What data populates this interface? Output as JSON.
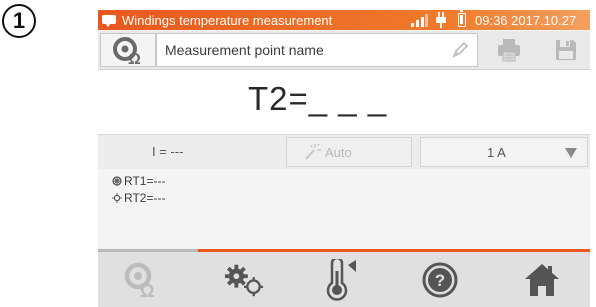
{
  "step_badge": "1",
  "status_bar": {
    "title": "Windings temperature measurement",
    "clock": "09:36 2017.10.27"
  },
  "name_row": {
    "placeholder": "Measurement point name"
  },
  "result": {
    "value": "T2=_ _ _"
  },
  "params": {
    "current": "I = ---",
    "auto_label": "Auto",
    "range_value": "1 A"
  },
  "sub_results": [
    {
      "label": "RT1=---"
    },
    {
      "label": "RT2=---"
    }
  ],
  "progress": {
    "fraction": 1.0
  },
  "toolbar": {
    "icons": [
      "probe-icon",
      "settings-gears-icon",
      "thermometer-icon",
      "help-icon",
      "home-icon"
    ]
  },
  "colors": {
    "accent": "#e8581e",
    "icon_gray": "#666666",
    "icon_disabled": "#b0b0b0"
  }
}
